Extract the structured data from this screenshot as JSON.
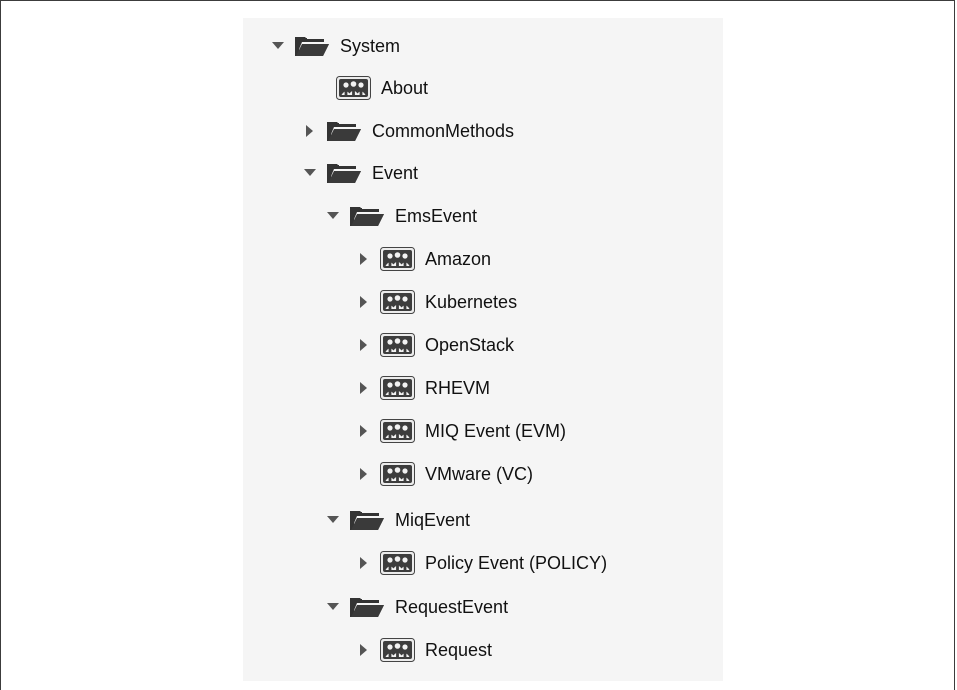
{
  "colors": {
    "background": "#ffffff",
    "panel": "#f5f5f5",
    "folder": "#333333",
    "arrow": "#555555",
    "text": "#111111"
  },
  "tree": {
    "system": {
      "label": "System",
      "icon": "folder-open-icon",
      "toggle": "expanded"
    },
    "about": {
      "label": "About",
      "icon": "namespace-icon",
      "toggle": "none"
    },
    "common_methods": {
      "label": "CommonMethods",
      "icon": "folder-open-icon",
      "toggle": "collapsed"
    },
    "event": {
      "label": "Event",
      "icon": "folder-open-icon",
      "toggle": "expanded"
    },
    "ems_event": {
      "label": "EmsEvent",
      "icon": "folder-open-icon",
      "toggle": "expanded"
    },
    "amazon": {
      "label": "Amazon",
      "icon": "namespace-icon",
      "toggle": "collapsed"
    },
    "kubernetes": {
      "label": "Kubernetes",
      "icon": "namespace-icon",
      "toggle": "collapsed"
    },
    "openstack": {
      "label": "OpenStack",
      "icon": "namespace-icon",
      "toggle": "collapsed"
    },
    "rhevm": {
      "label": "RHEVM",
      "icon": "namespace-icon",
      "toggle": "collapsed"
    },
    "miq_event_evm": {
      "label": "MIQ Event (EVM)",
      "icon": "namespace-icon",
      "toggle": "collapsed"
    },
    "vmware_vc": {
      "label": "VMware (VC)",
      "icon": "namespace-icon",
      "toggle": "collapsed"
    },
    "miq_event": {
      "label": "MiqEvent",
      "icon": "folder-open-icon",
      "toggle": "expanded"
    },
    "policy_event": {
      "label": "Policy Event (POLICY)",
      "icon": "namespace-icon",
      "toggle": "collapsed"
    },
    "request_event": {
      "label": "RequestEvent",
      "icon": "folder-open-icon",
      "toggle": "expanded"
    },
    "request": {
      "label": "Request",
      "icon": "namespace-icon",
      "toggle": "collapsed"
    }
  }
}
